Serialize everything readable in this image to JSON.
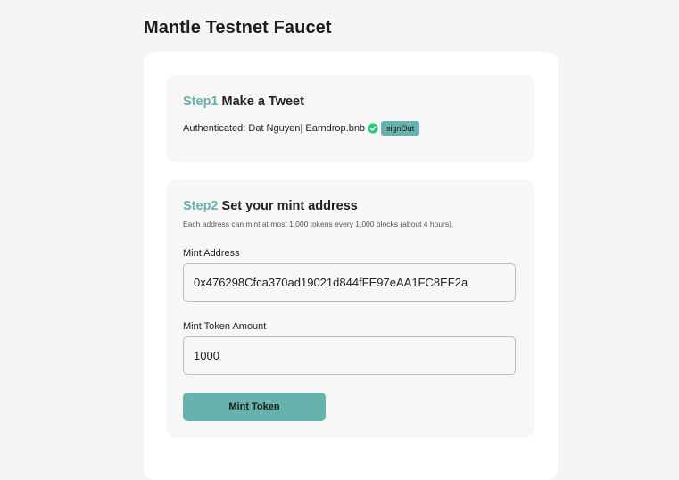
{
  "page": {
    "title": "Mantle Testnet Faucet"
  },
  "step1": {
    "number": "Step1",
    "title": "Make a Tweet",
    "authenticated_text": "Authenticated: Dat Nguyen| Earndrop.bnb",
    "verified_icon": "verified-check-icon",
    "signout_label": "signOut"
  },
  "step2": {
    "number": "Step2",
    "title": "Set your mint address",
    "description": "Each address can mint at most 1,000 tokens every 1,000 blocks (about 4 hours).",
    "mint_address_label": "Mint Address",
    "mint_address_value": "0x476298Cfca370ad19021d844fFE97eAA1FC8EF2a",
    "amount_label": "Mint Token Amount",
    "amount_value": "1000",
    "mint_button_label": "Mint Token"
  },
  "colors": {
    "accent": "#66b2ad",
    "verified": "#2ecc71",
    "background": "#f5f5f5",
    "card": "#ffffff",
    "step_box": "#f7f7f7"
  }
}
